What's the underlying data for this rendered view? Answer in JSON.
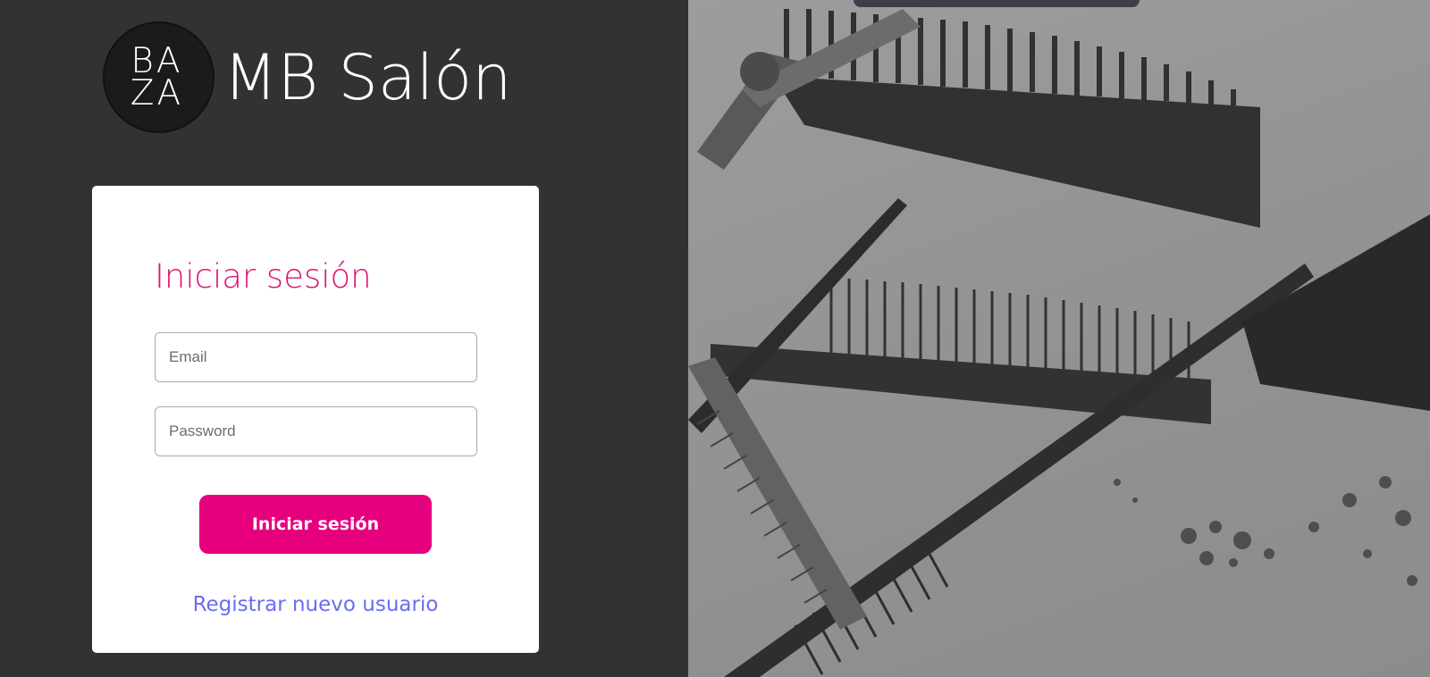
{
  "brand": {
    "logo_line1": "BA",
    "logo_line2": "ZA",
    "name": "MB Salón"
  },
  "login": {
    "title": "Iniciar sesión",
    "email_placeholder": "Email",
    "password_placeholder": "Password",
    "submit_label": "Iniciar sesión",
    "register_label": "Registrar nuevo usuario"
  },
  "colors": {
    "background": "#333232",
    "accent_pink": "#e6007e",
    "title_pink": "#dd1377",
    "link_blue": "#6a6cf3"
  },
  "icons": [
    "baza-logo",
    "combs-photo"
  ]
}
